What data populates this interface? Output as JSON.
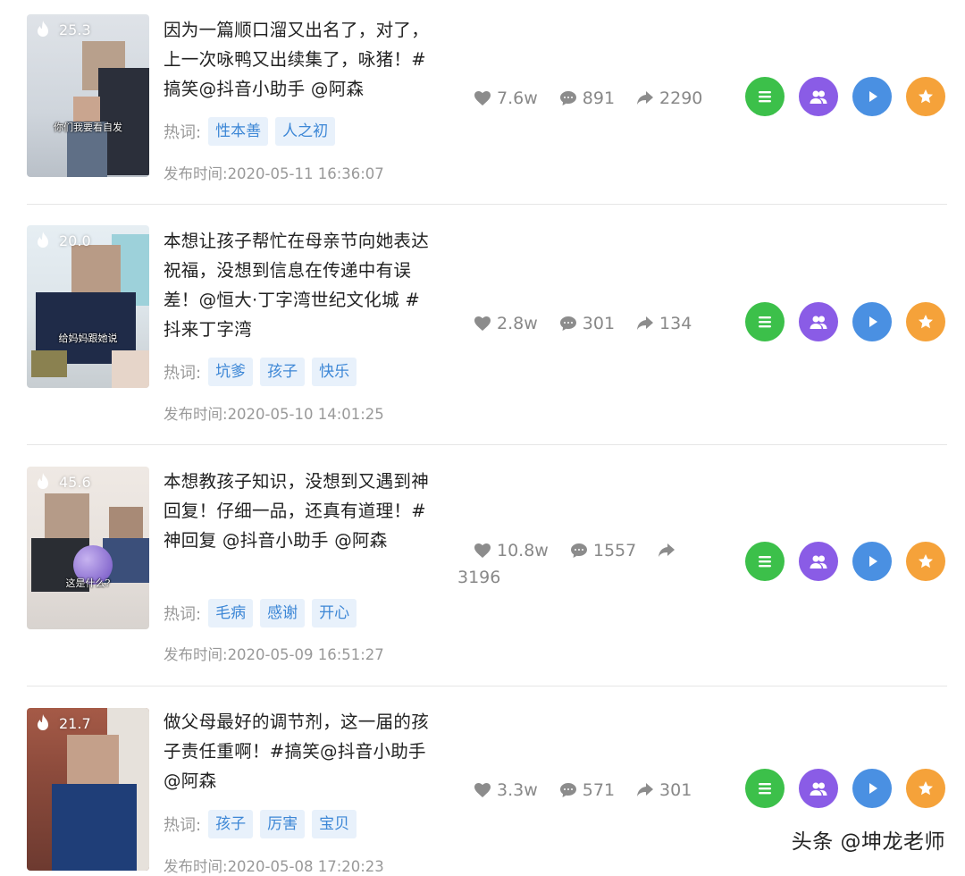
{
  "labels": {
    "hot_words": "热词:",
    "publish_time": "发布时间:"
  },
  "colors": {
    "list_button": "#3cc04a",
    "fans_button": "#8a5ce6",
    "play_button": "#4a90e2",
    "star_button": "#f5a23a",
    "tag_bg": "#e8f1fb",
    "tag_text": "#3d87d6"
  },
  "icons": {
    "heat": "flame-icon",
    "like": "heart-icon",
    "comment": "comment-bubble-icon",
    "share": "share-arrow-icon",
    "list": "list-icon",
    "fans": "users-icon",
    "play": "play-icon",
    "star": "star-icon"
  },
  "items": [
    {
      "heat": "25.3",
      "title": "因为一篇顺口溜又出名了，对了，上一次咏鸭又出续集了，咏猪！#搞笑@抖音小助手 @阿森",
      "tags": [
        "性本善",
        "人之初"
      ],
      "date": "2020-05-11 16:36:07",
      "likes": "7.6w",
      "comments": "891",
      "shares": "2290",
      "caption": "你们我要看自发"
    },
    {
      "heat": "20.0",
      "title": "本想让孩子帮忙在母亲节向她表达祝福，没想到信息在传递中有误差！@恒大·丁字湾世纪文化城 #抖来丁字湾",
      "tags": [
        "坑爹",
        "孩子",
        "快乐"
      ],
      "date": "2020-05-10 14:01:25",
      "likes": "2.8w",
      "comments": "301",
      "shares": "134",
      "caption": "给妈妈跟她说"
    },
    {
      "heat": "45.6",
      "title": "本想教孩子知识，没想到又遇到神回复！仔细一品，还真有道理！#神回复 @抖音小助手 @阿森",
      "tags": [
        "毛病",
        "感谢",
        "开心"
      ],
      "date": "2020-05-09 16:51:27",
      "likes": "10.8w",
      "comments": "1557",
      "shares": "3196",
      "caption": "这是什么?"
    },
    {
      "heat": "21.7",
      "title": "做父母最好的调节剂，这一届的孩子责任重啊！#搞笑@抖音小助手 @阿森",
      "tags": [
        "孩子",
        "厉害",
        "宝贝"
      ],
      "date": "2020-05-08 17:20:23",
      "likes": "3.3w",
      "comments": "571",
      "shares": "301",
      "caption": ""
    }
  ],
  "watermark": "头条 @坤龙老师"
}
